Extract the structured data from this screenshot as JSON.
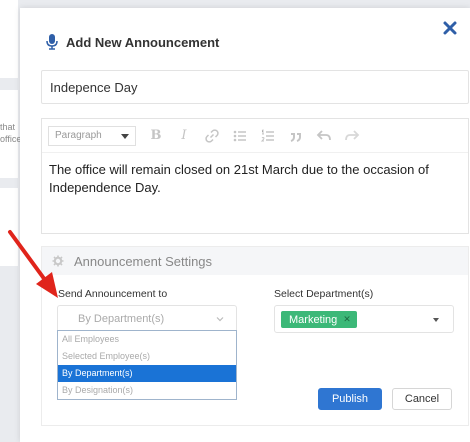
{
  "background": {
    "fragment_1": "that",
    "fragment_2": "office"
  },
  "modal": {
    "title": "Add New Announcement",
    "title_value": "Indepence Day",
    "close_icon": "close-icon"
  },
  "editor": {
    "format_select": "Paragraph",
    "toolbar_icons": [
      "bold-icon",
      "italic-icon",
      "link-icon",
      "bulleted-list-icon",
      "numbered-list-icon",
      "quote-icon",
      "undo-icon",
      "redo-icon"
    ],
    "body": "The office will remain closed on 21st March due to the occasion of Independence Day."
  },
  "settings": {
    "title": "Announcement Settings",
    "send_label": "Send Announcement to",
    "send_placeholder": "By Department(s)",
    "send_options": [
      "All Employees",
      "Selected Employee(s)",
      "By Department(s)",
      "By Designation(s)"
    ],
    "send_selected_index": 2,
    "dept_label": "Select Department(s)",
    "dept_tags": [
      "Marketing"
    ]
  },
  "actions": {
    "publish": "Publish",
    "cancel": "Cancel"
  },
  "colors": {
    "primary": "#2f76d2",
    "tag": "#3cb878",
    "highlight": "#1a73d6",
    "arrow": "#e0241b"
  }
}
